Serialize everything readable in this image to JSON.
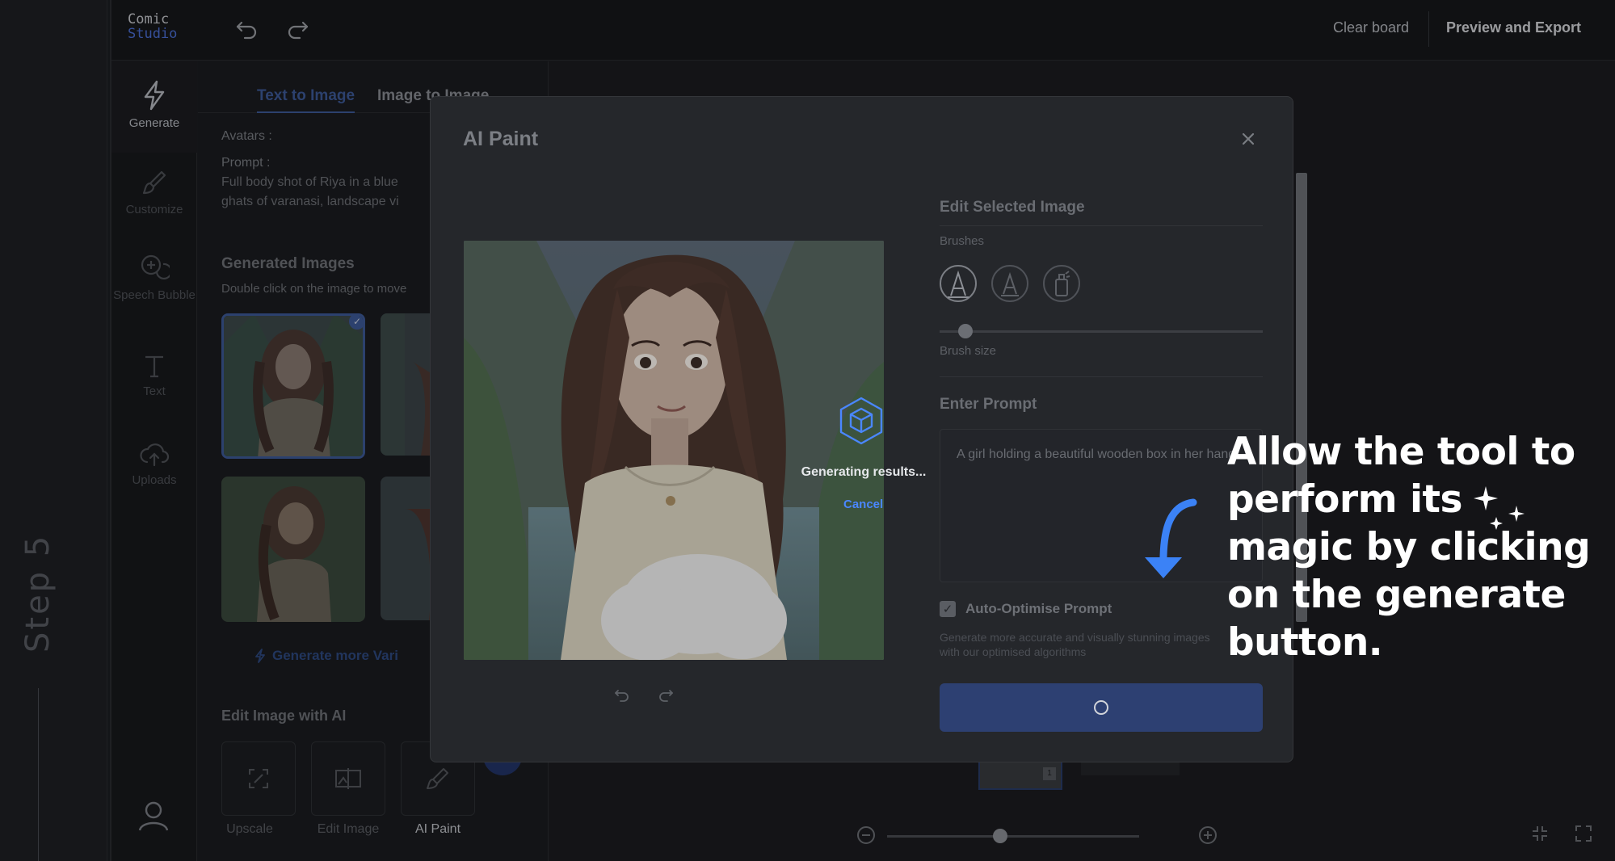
{
  "step": {
    "label": "Step 5"
  },
  "app": {
    "logo_line1": "Comic",
    "logo_line2": "Studio",
    "clear_board": "Clear board",
    "preview_export": "Preview and Export"
  },
  "nav": {
    "items": [
      {
        "label": "Generate"
      },
      {
        "label": "Customize"
      },
      {
        "label": "Speech Bubble"
      },
      {
        "label": "Text"
      },
      {
        "label": "Uploads"
      }
    ]
  },
  "panel": {
    "tab_text_to_image": "Text to Image",
    "tab_image_to_image": "Image to Image",
    "avatars_label": "Avatars :",
    "prompt_label": "Prompt :",
    "prompt_line1": "Full body shot of Riya in a blue",
    "prompt_line2": "ghats of varanasi, landscape vi",
    "generated_heading": "Generated Images",
    "generated_hint": "Double click on the image to move",
    "generate_more": "Generate more Vari",
    "edit_heading": "Edit Image with AI",
    "tools": [
      {
        "label": "Upscale"
      },
      {
        "label": "Edit Image"
      },
      {
        "label": "AI Paint"
      }
    ]
  },
  "modal": {
    "title": "AI Paint",
    "generating_text": "Generating results...",
    "cancel": "Cancel",
    "edit_selected_title": "Edit Selected Image",
    "brushes_label": "Brushes",
    "brush_size_label": "Brush size",
    "brush_size_value": 0.08,
    "enter_prompt_title": "Enter Prompt",
    "prompt_value": "A girl holding a beautiful wooden box in her hand",
    "auto_optimise_label": "Auto-Optimise Prompt",
    "auto_optimise_checked": true,
    "auto_optimise_desc": "Generate more accurate and visually stunning images with our optimised algorithms"
  },
  "zoom": {
    "level": 0.45
  },
  "annotation": {
    "text": "Allow the tool to perform its magic by clicking on the generate button."
  },
  "colors": {
    "accent": "#4a87ff",
    "annotation_arrow": "#3b82f6"
  }
}
